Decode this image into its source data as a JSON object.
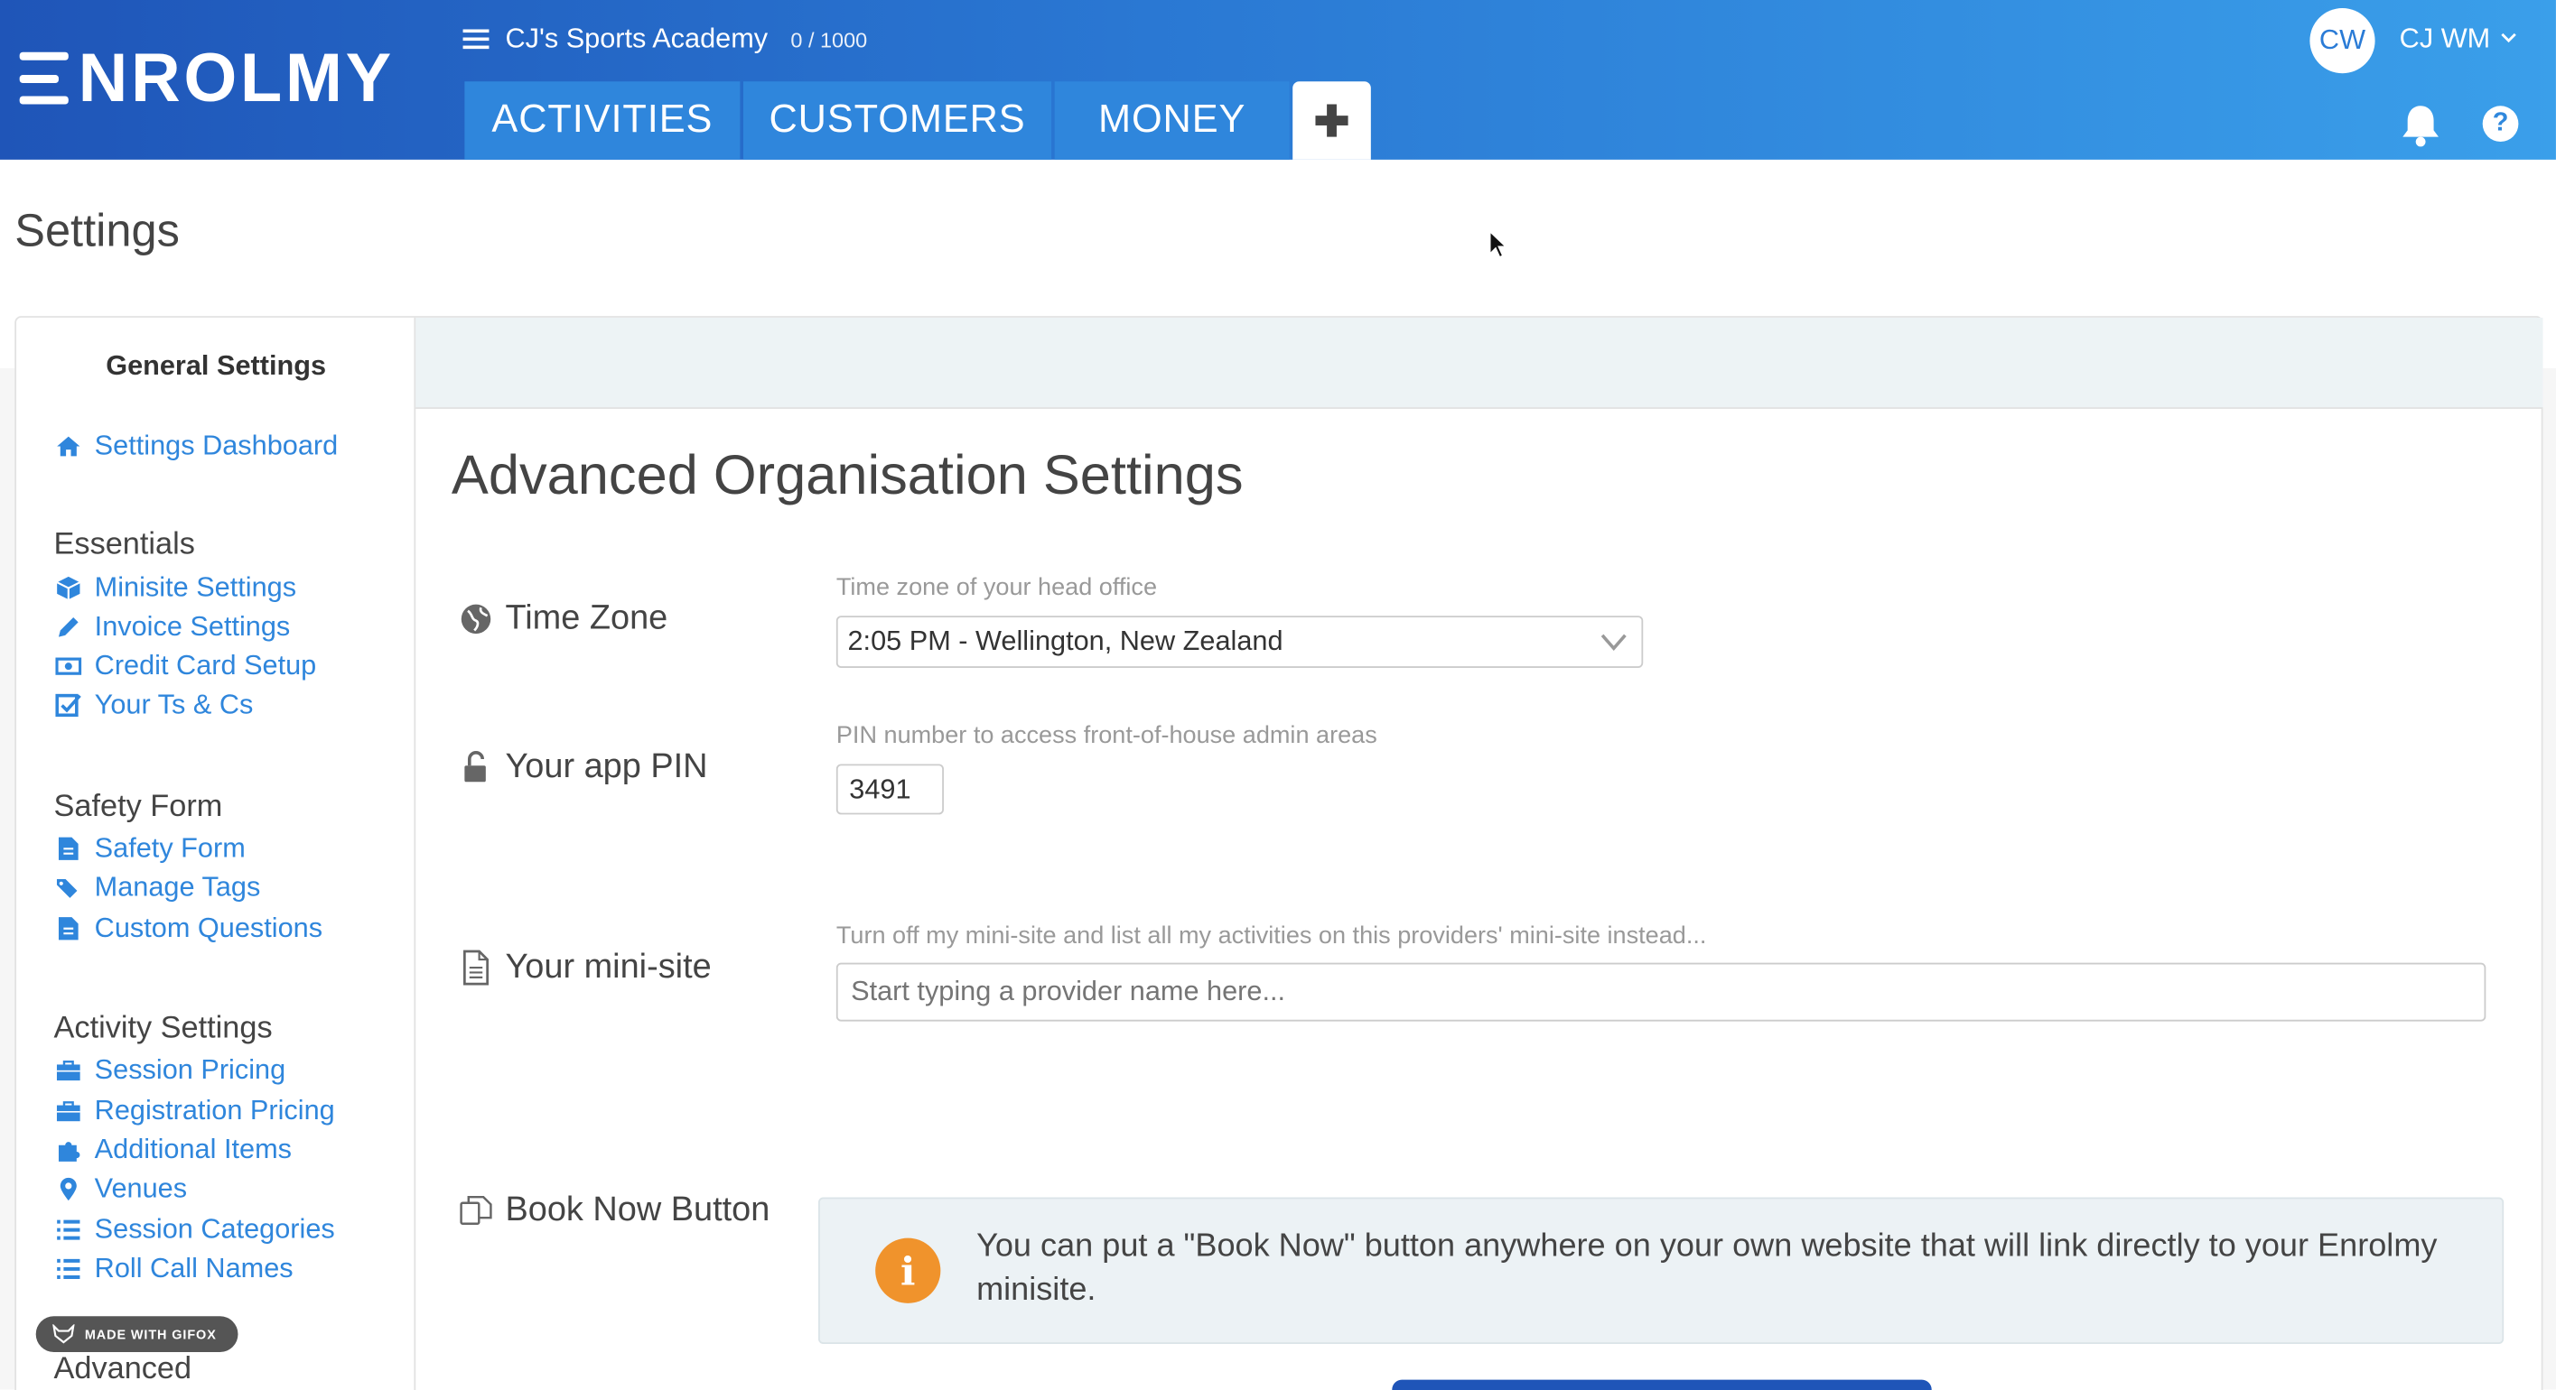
{
  "header": {
    "logo": "NROLMY",
    "org_name": "CJ's Sports Academy",
    "org_count": "0 / 1000",
    "tabs": [
      {
        "label": "ACTIVITIES"
      },
      {
        "label": "CUSTOMERS"
      },
      {
        "label": "MONEY"
      }
    ],
    "avatar_initials": "CW",
    "user_name": "CJ WM",
    "help_glyph": "?"
  },
  "page": {
    "title": "Settings"
  },
  "sidebar": {
    "title": "General Settings",
    "dashboard": "Settings Dashboard",
    "sections": [
      {
        "heading": "Essentials",
        "items": [
          "Minisite Settings",
          "Invoice Settings",
          "Credit Card Setup",
          "Your Ts & Cs"
        ]
      },
      {
        "heading": "Safety Form",
        "items": [
          "Safety Form",
          "Manage Tags",
          "Custom Questions"
        ]
      },
      {
        "heading": "Activity Settings",
        "items": [
          "Session Pricing",
          "Registration Pricing",
          "Additional Items",
          "Venues",
          "Session Categories",
          "Roll Call Names"
        ]
      },
      {
        "heading": "Advanced",
        "items": []
      }
    ]
  },
  "main": {
    "title": "Advanced Organisation Settings",
    "timezone": {
      "label": "Time Zone",
      "hint": "Time zone of your head office",
      "value": "2:05 PM - Wellington, New Zealand"
    },
    "pin": {
      "label": "Your app PIN",
      "hint": "PIN number to access front-of-house admin areas",
      "value": "3491"
    },
    "minisite": {
      "label": "Your mini-site",
      "hint": "Turn off my mini-site and list all my activities on this providers' mini-site instead...",
      "placeholder": "Start typing a provider name here..."
    },
    "book_now": {
      "label": "Book Now Button",
      "info_glyph": "i",
      "info": "You can put a \"Book Now\" button anywhere on your own website that will link directly to your Enrolmy minisite."
    }
  },
  "badge": {
    "gifox": "MADE WITH GIFOX"
  },
  "colors": {
    "accent": "#2f86dc",
    "header_start": "#1f55b8",
    "info_icon": "#f0932c"
  }
}
